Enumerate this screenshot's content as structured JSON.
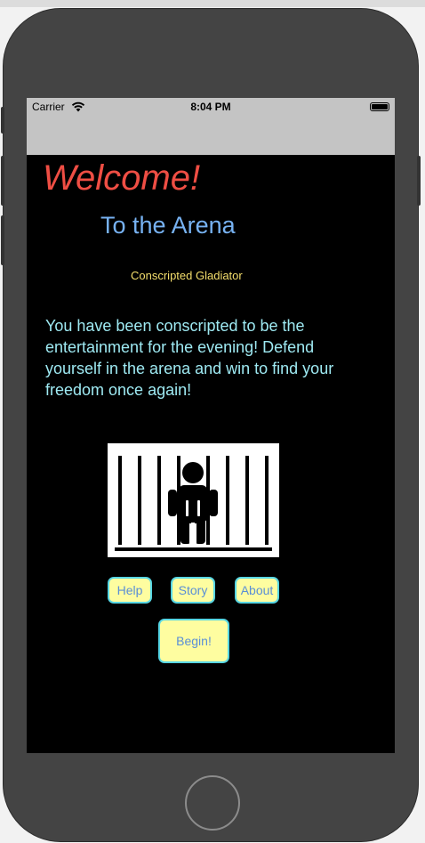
{
  "status_bar": {
    "carrier": "Carrier",
    "time": "8:04 PM",
    "wifi_icon": "wifi-icon",
    "battery_icon": "battery-icon"
  },
  "header": {
    "welcome": "Welcome!",
    "subtitle": "To the Arena"
  },
  "character": {
    "role": "Conscripted Gladiator"
  },
  "intro": {
    "text": "You have been conscripted to be the entertainment for the evening! Defend yourself in the arena and win to find your freedom once again!"
  },
  "image": {
    "icon": "prisoner-behind-bars-icon"
  },
  "buttons": {
    "help": "Help",
    "story": "Story",
    "about": "About",
    "begin": "Begin!"
  },
  "colors": {
    "welcome": "#ef4e44",
    "subtitle": "#77b2f2",
    "role": "#f5df6c",
    "intro": "#9ee9f2",
    "button_fill": "#fefda0",
    "button_border": "#57d6e3",
    "button_text": "#5a8fd6",
    "screen_background": "#000000",
    "status_bar": "#c4c4c4"
  }
}
